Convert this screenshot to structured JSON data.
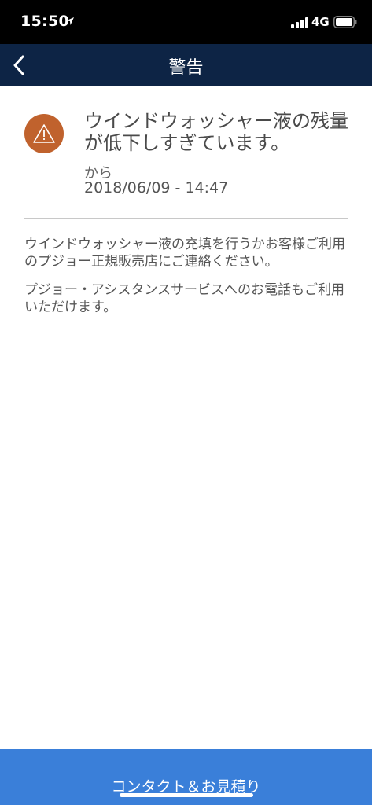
{
  "status_bar": {
    "time": "15:50",
    "network": "4G",
    "icons": [
      "location-arrow-icon",
      "signal-icon",
      "battery-icon"
    ]
  },
  "nav": {
    "title": "警告",
    "back_icon": "chevron-left-icon"
  },
  "alert": {
    "icon": "warning-icon",
    "icon_color": "#c0622d",
    "title": "ウインドウォッシャー液の残量が低下しすぎています。",
    "from_label": "から",
    "datetime": "2018/06/09 - 14:47",
    "messages": [
      "ウインドウォッシャー液の充填を行うかお客様ご利用のプジョー正規販売店にご連絡ください。",
      "プジョー・アシスタンスサービスへのお電話もご利用いただけます。"
    ]
  },
  "footer": {
    "contact_label": "コンタクト＆お見積り",
    "button_color": "#3a7fd9"
  },
  "colors": {
    "nav_background": "#0d2445",
    "status_background": "#000000"
  }
}
